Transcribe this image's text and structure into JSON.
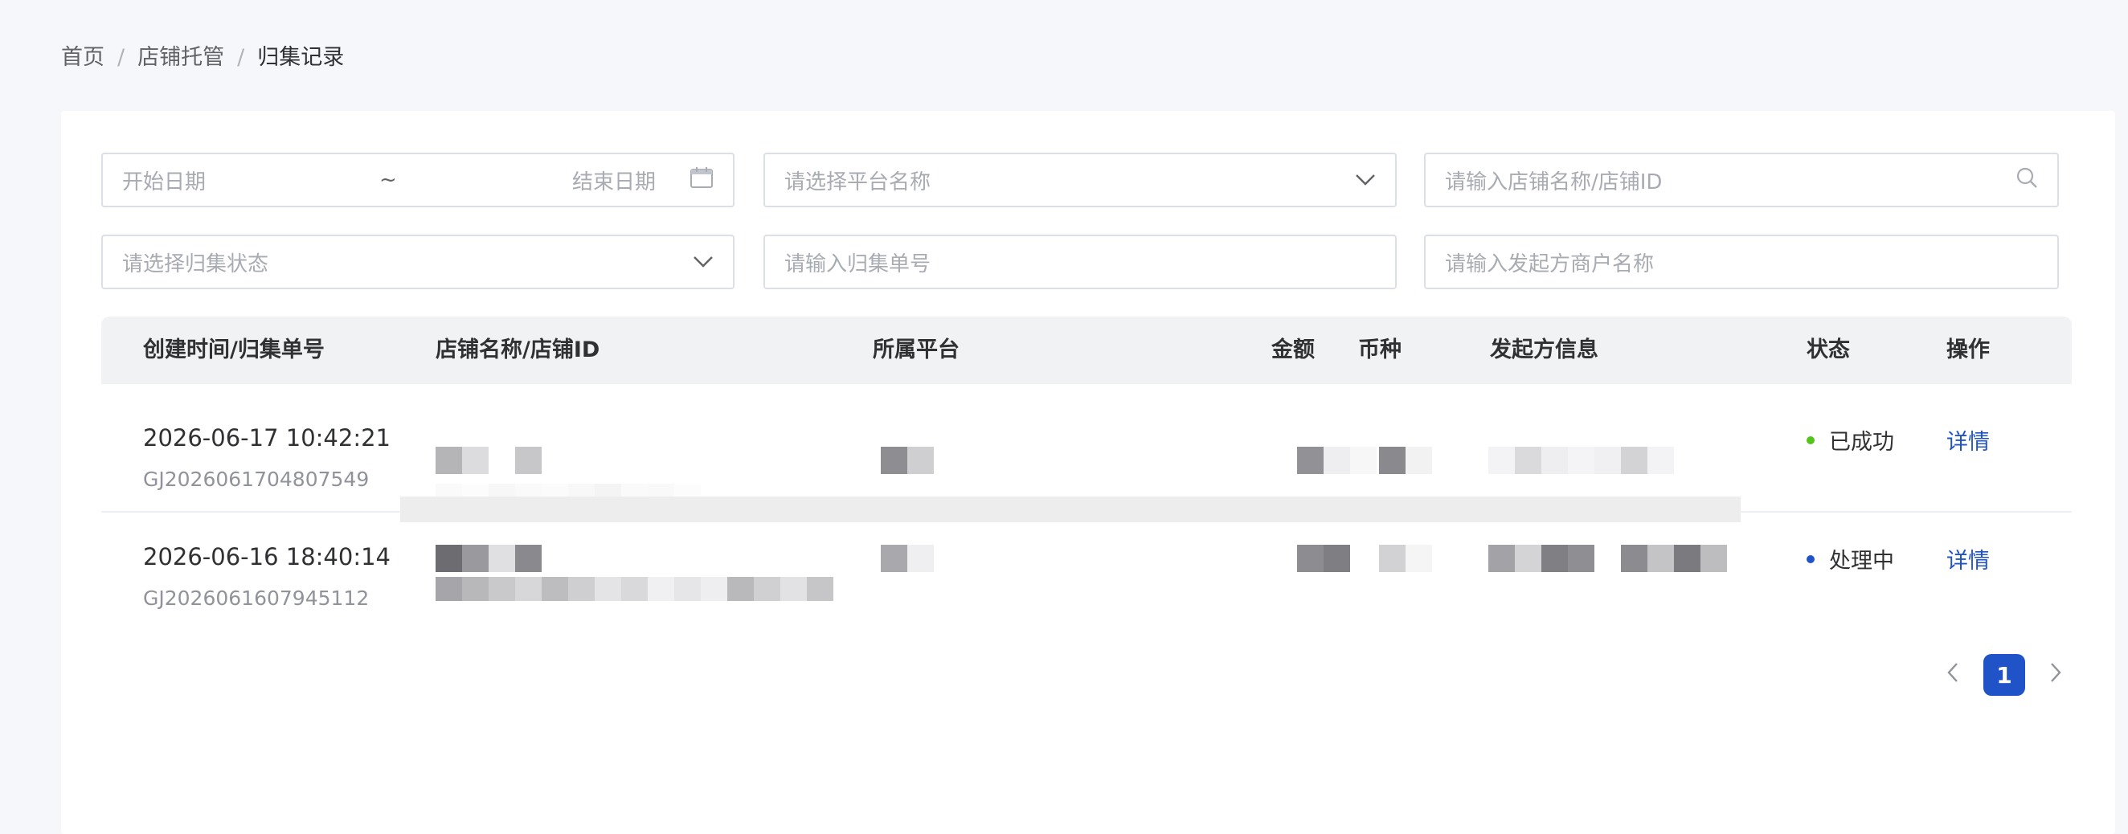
{
  "breadcrumb": {
    "home": "首页",
    "section": "店铺托管",
    "current": "归集记录",
    "separator": "/"
  },
  "filters": {
    "start_date_placeholder": "开始日期",
    "range_separator": "~",
    "end_date_placeholder": "结束日期",
    "platform_placeholder": "请选择平台名称",
    "shop_placeholder": "请输入店铺名称/店铺ID",
    "status_placeholder": "请选择归集状态",
    "order_no_placeholder": "请输入归集单号",
    "merchant_placeholder": "请输入发起方商户名称"
  },
  "table": {
    "columns": {
      "time_order": "创建时间/归集单号",
      "shop": "店铺名称/店铺ID",
      "platform": "所属平台",
      "amount": "金额",
      "currency": "币种",
      "initiator": "发起方信息",
      "status": "状态",
      "action": "操作"
    },
    "rows": [
      {
        "time": "2026-06-17 10:42:21",
        "order_no": "GJ2026061704807549",
        "status": "已成功",
        "status_color": "#52c41a",
        "action": "详情"
      },
      {
        "time": "2026-06-16 18:40:14",
        "order_no": "GJ2026061607945112",
        "status": "处理中",
        "status_color": "#1f53c7",
        "action": "详情"
      }
    ]
  },
  "pagination": {
    "prev_icon": "chevron-left-icon",
    "current_page": "1",
    "next_icon": "chevron-right-icon"
  },
  "colors": {
    "accent": "#1f53c7",
    "success": "#52c41a",
    "page_bg": "#f6f7fb"
  }
}
